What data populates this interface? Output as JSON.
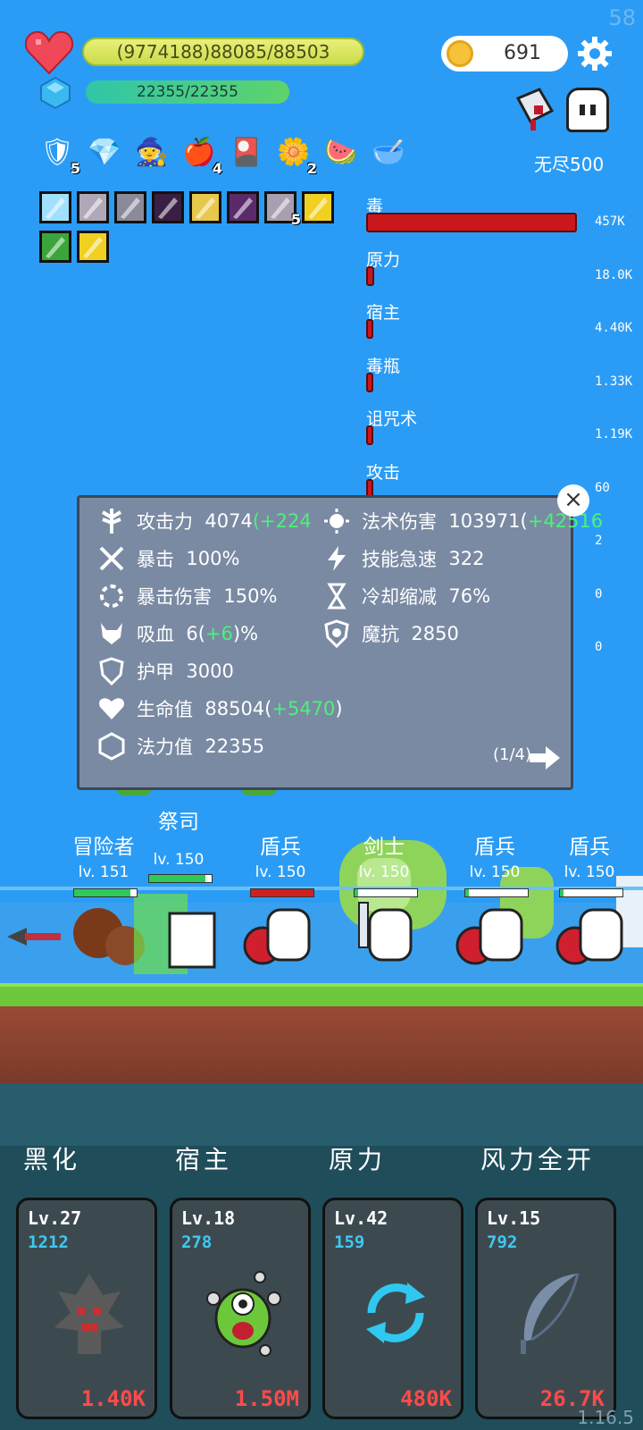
{
  "fps": "58",
  "version": "1.16.5",
  "player": {
    "hp_text": "(9774188)88085/88503",
    "mp_text": "22355/22355"
  },
  "coins": "691",
  "mode": "无尽500",
  "items": [
    {
      "name": "shield-item",
      "glyph": "🛡",
      "count": "5"
    },
    {
      "name": "ruby-item",
      "glyph": "💎",
      "count": ""
    },
    {
      "name": "wizard-hat-item",
      "glyph": "🧙",
      "count": ""
    },
    {
      "name": "apple-item",
      "glyph": "🍎",
      "count": "4"
    },
    {
      "name": "card-item",
      "glyph": "🎴",
      "count": ""
    },
    {
      "name": "flower-item",
      "glyph": "🌼",
      "count": "2"
    },
    {
      "name": "watermelon-item",
      "glyph": "🍉",
      "count": ""
    },
    {
      "name": "mortar-item",
      "glyph": "🥣",
      "count": ""
    }
  ],
  "skill_icons": [
    {
      "name": "light-skill-icon",
      "color": "#9fe0ff",
      "count": ""
    },
    {
      "name": "slash-skill-icon",
      "color": "#b0a8b8",
      "count": ""
    },
    {
      "name": "slash2-skill-icon",
      "color": "#8a8a9a",
      "count": ""
    },
    {
      "name": "dark-skill-icon",
      "color": "#3a1e44",
      "count": ""
    },
    {
      "name": "armor-skill-icon",
      "color": "#e8c84a",
      "count": ""
    },
    {
      "name": "demon-skill-icon",
      "color": "#5a2a6a",
      "count": ""
    },
    {
      "name": "blade-skill-icon",
      "color": "#a8a0b0",
      "count": "5"
    },
    {
      "name": "yellow-skill-icon",
      "color": "#f0d020",
      "count": ""
    },
    {
      "name": "poison-skill-icon",
      "color": "#3aa53a",
      "count": ""
    },
    {
      "name": "yellow2-skill-icon",
      "color": "#f0d020",
      "count": ""
    }
  ],
  "damage_meter": [
    {
      "label": "毒",
      "value": "457K",
      "fill": 1.0
    },
    {
      "label": "原力",
      "value": "18.0K",
      "fill": 0.04
    },
    {
      "label": "宿主",
      "value": "4.40K",
      "fill": 0.01
    },
    {
      "label": "毒瓶",
      "value": "1.33K",
      "fill": 0.003
    },
    {
      "label": "诅咒术",
      "value": "1.19K",
      "fill": 0.003
    },
    {
      "label": "攻击",
      "value": "60",
      "fill": 0.0001
    },
    {
      "label": "",
      "value": "2",
      "fill": 0
    },
    {
      "label": "",
      "value": "0",
      "fill": 0
    },
    {
      "label": "",
      "value": "0",
      "fill": 0
    }
  ],
  "stats": {
    "left": [
      {
        "name": "attack-stat",
        "label": "攻击力",
        "value": "4074",
        "bonus": "(+224"
      },
      {
        "name": "crit-stat",
        "label": "暴击",
        "value": "100%",
        "bonus": ""
      },
      {
        "name": "crit-damage-stat",
        "label": "暴击伤害",
        "value": "150%",
        "bonus": ""
      },
      {
        "name": "lifesteal-stat",
        "label": "吸血",
        "value": "6(",
        "bonus": "+6",
        "suffix": ")%"
      },
      {
        "name": "armor-stat",
        "label": "护甲",
        "value": "3000",
        "bonus": ""
      },
      {
        "name": "hp-stat",
        "label": "生命值",
        "value": "88504(",
        "bonus": "+5470",
        "suffix": ")"
      },
      {
        "name": "mana-stat",
        "label": "法力值",
        "value": "22355",
        "bonus": ""
      }
    ],
    "right": [
      {
        "name": "spell-damage-stat",
        "label": "法术伤害",
        "value": "103971(",
        "bonus": "+42516"
      },
      {
        "name": "ability-haste-stat",
        "label": "技能急速",
        "value": "322",
        "bonus": ""
      },
      {
        "name": "cooldown-stat",
        "label": "冷却缩减",
        "value": "76%",
        "bonus": ""
      },
      {
        "name": "magic-resist-stat",
        "label": "魔抗",
        "value": "2850",
        "bonus": ""
      }
    ],
    "pager": "(1/4)"
  },
  "units": [
    {
      "name": "冒险者",
      "lv": "lv. 151",
      "hp": 0.9
    },
    {
      "name": "祭司",
      "lv": "lv. 150",
      "hp": 0.9
    },
    {
      "name": "盾兵",
      "lv": "lv. 150",
      "hp": 1.0,
      "red": true
    },
    {
      "name": "剑士",
      "lv": "lv. 150",
      "hp": 0.05
    },
    {
      "name": "盾兵",
      "lv": "lv. 150",
      "hp": 0.05
    },
    {
      "name": "盾兵",
      "lv": "lv. 150",
      "hp": 0.05
    }
  ],
  "skills": [
    {
      "title": "黑化",
      "lv": "Lv.27",
      "num": "1212",
      "cost": "1.40K"
    },
    {
      "title": "宿主",
      "lv": "Lv.18",
      "num": "278",
      "cost": "1.50M"
    },
    {
      "title": "原力",
      "lv": "Lv.42",
      "num": "159",
      "cost": "480K"
    },
    {
      "title": "风力全开",
      "lv": "Lv.15",
      "num": "792",
      "cost": "26.7K"
    }
  ]
}
